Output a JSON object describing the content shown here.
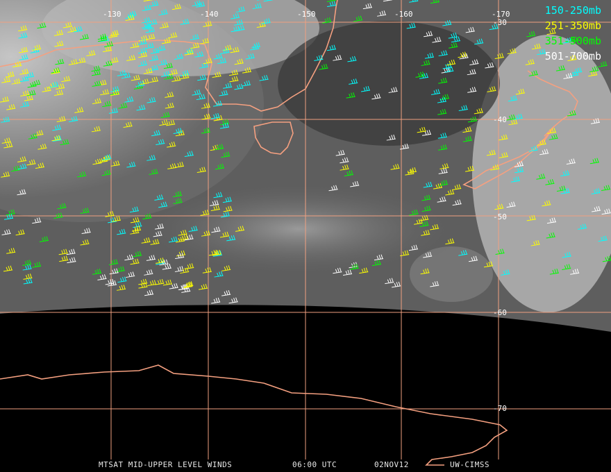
{
  "legend": [
    {
      "label": "150-250mb",
      "color": "#00ffff"
    },
    {
      "label": "251-350mb",
      "color": "#ffff00"
    },
    {
      "label": "351-500mb",
      "color": "#00ff00"
    },
    {
      "label": "501-700mb",
      "color": "#ffffff"
    }
  ],
  "longitude_labels": [
    "-130",
    "-140",
    "-150",
    "-160",
    "-170"
  ],
  "latitude_labels": [
    "-30",
    "-40",
    "-50",
    "-60",
    "-70"
  ],
  "footer": {
    "product": "MTSAT MID-UPPER LEVEL WINDS",
    "time": "06:00 UTC",
    "date": "02NOV12",
    "source": "UW-CIMSS"
  },
  "colors": {
    "grid": "#f0a080",
    "coast": "#f5a080",
    "space": "#000000"
  }
}
